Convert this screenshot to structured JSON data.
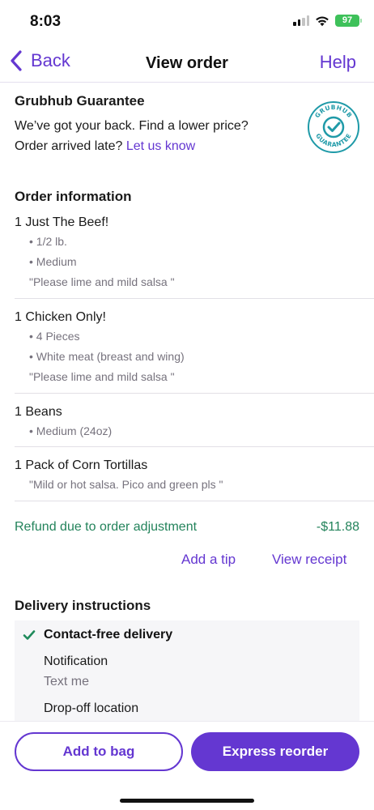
{
  "status_bar": {
    "time": "8:03",
    "battery": "97",
    "icons": [
      "signal-icon",
      "wifi-icon",
      "battery-icon"
    ]
  },
  "nav": {
    "back_label": "Back",
    "title": "View order",
    "help_label": "Help"
  },
  "guarantee": {
    "title": "Grubhub Guarantee",
    "line1": "We’ve got your back. Find a lower price?",
    "line2": "Order arrived late?",
    "link": "Let us know",
    "badge_top": "GRUBHUB",
    "badge_bottom": "GUARANTEE"
  },
  "order_info": {
    "title": "Order information",
    "items": [
      {
        "name": "1 Just The Beef!",
        "options": [
          "• 1/2 lb.",
          "• Medium"
        ],
        "note": "\"Please lime and mild salsa \""
      },
      {
        "name": "1 Chicken Only!",
        "options": [
          "• 4 Pieces",
          "• White meat (breast and wing)"
        ],
        "note": "\"Please lime and mild salsa \""
      },
      {
        "name": "1 Beans",
        "options": [
          "• Medium (24oz)"
        ],
        "note": ""
      },
      {
        "name": "1 Pack of Corn Tortillas",
        "options": [],
        "note": "\"Mild or hot salsa. Pico and green pls \""
      }
    ]
  },
  "refund": {
    "label": "Refund due to order adjustment",
    "amount": "-$11.88"
  },
  "actions": {
    "add_tip": "Add a tip",
    "view_receipt": "View receipt"
  },
  "delivery": {
    "title": "Delivery instructions",
    "option": "Contact-free delivery",
    "notification_label": "Notification",
    "notification_value": "Text me",
    "dropoff_label": "Drop-off location"
  },
  "buttons": {
    "add_to_bag": "Add to bag",
    "express_reorder": "Express reorder"
  },
  "colors": {
    "accent": "#6437d1",
    "refund_green": "#23835b",
    "badge_teal": "#1f9aa8",
    "check_green": "#1f8a5b"
  }
}
